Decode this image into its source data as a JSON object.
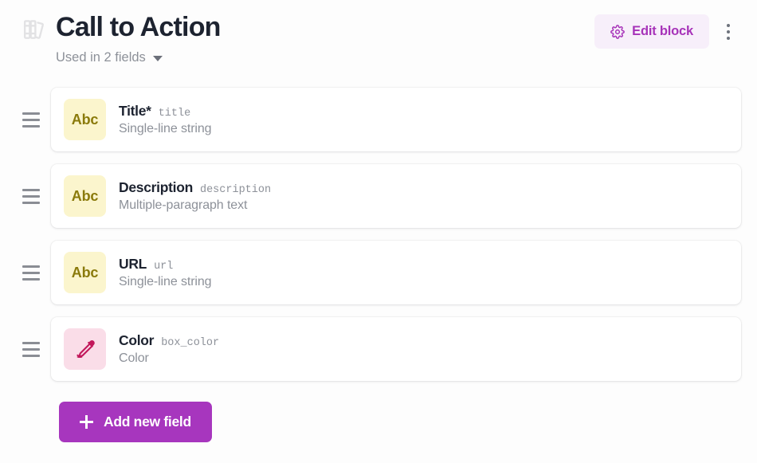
{
  "header": {
    "icon": "books-icon",
    "title": "Call to Action",
    "subtitle": "Used in 2 fields",
    "subtitle_caret": "chevron-down-icon",
    "edit_block_label": "Edit block",
    "edit_block_icon": "gear-icon",
    "overflow_icon": "kebab-menu-icon",
    "accent_color": "#a733b9"
  },
  "fields": [
    {
      "badge_kind": "abc",
      "badge_text": "Abc",
      "badge_bg": "#fbf5cd",
      "badge_fg": "#8a7a0b",
      "label": "Title*",
      "key": "title",
      "description": "Single-line string",
      "drag_handle": "drag-handle-icon"
    },
    {
      "badge_kind": "abc",
      "badge_text": "Abc",
      "badge_bg": "#fbf5cd",
      "badge_fg": "#8a7a0b",
      "label": "Description",
      "key": "description",
      "description": "Multiple-paragraph text",
      "drag_handle": "drag-handle-icon"
    },
    {
      "badge_kind": "abc",
      "badge_text": "Abc",
      "badge_bg": "#fbf5cd",
      "badge_fg": "#8a7a0b",
      "label": "URL",
      "key": "url",
      "description": "Single-line string",
      "drag_handle": "drag-handle-icon"
    },
    {
      "badge_kind": "color",
      "badge_text": "",
      "badge_bg": "#fadde8",
      "badge_fg": "#c2185b",
      "badge_icon": "eyedropper-icon",
      "label": "Color",
      "key": "box_color",
      "description": "Color",
      "drag_handle": "drag-handle-icon"
    }
  ],
  "footer": {
    "add_field_label": "Add new field",
    "add_field_icon": "plus-icon",
    "add_field_color": "#a736be"
  }
}
